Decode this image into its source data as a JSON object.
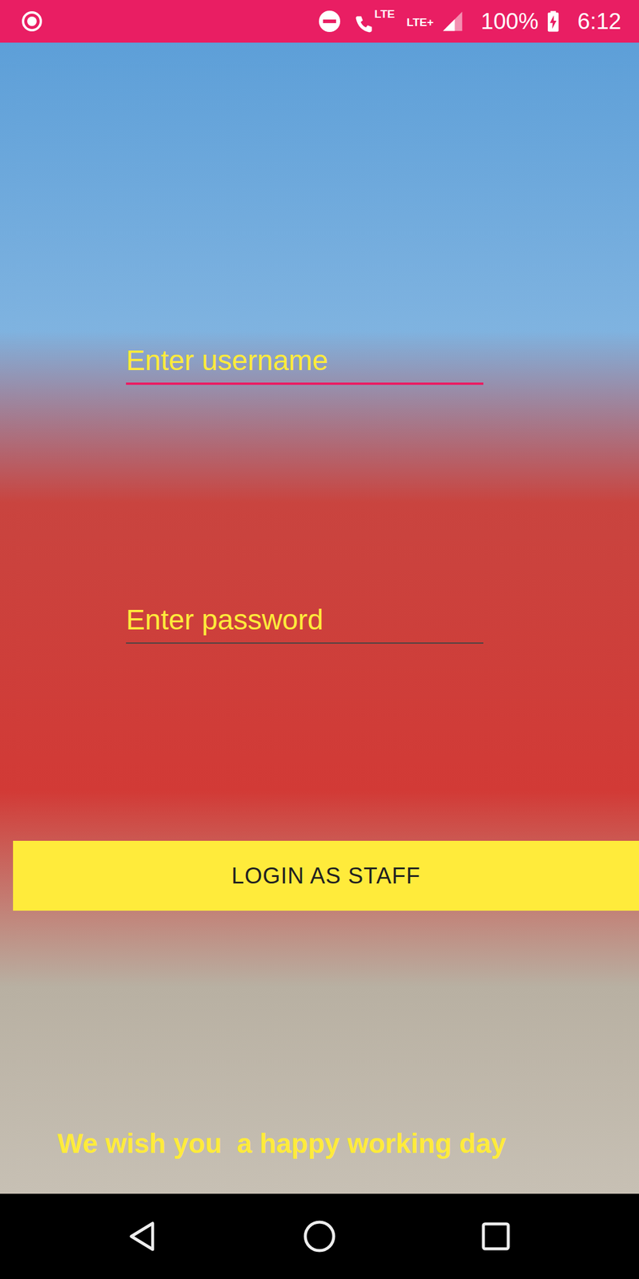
{
  "status_bar": {
    "network_left": "LTE",
    "network_right": "LTE+",
    "battery": "100%",
    "time": "6:12"
  },
  "form": {
    "fields": [
      {
        "name": "username",
        "placeholder": "Enter username",
        "type": "text",
        "focused": true
      },
      {
        "name": "password",
        "placeholder": "Enter password",
        "type": "password",
        "focused": false
      }
    ]
  },
  "login_button": {
    "label": "LOGIN AS STAFF"
  },
  "footer": {
    "message": "We wish you  a happy working day"
  }
}
